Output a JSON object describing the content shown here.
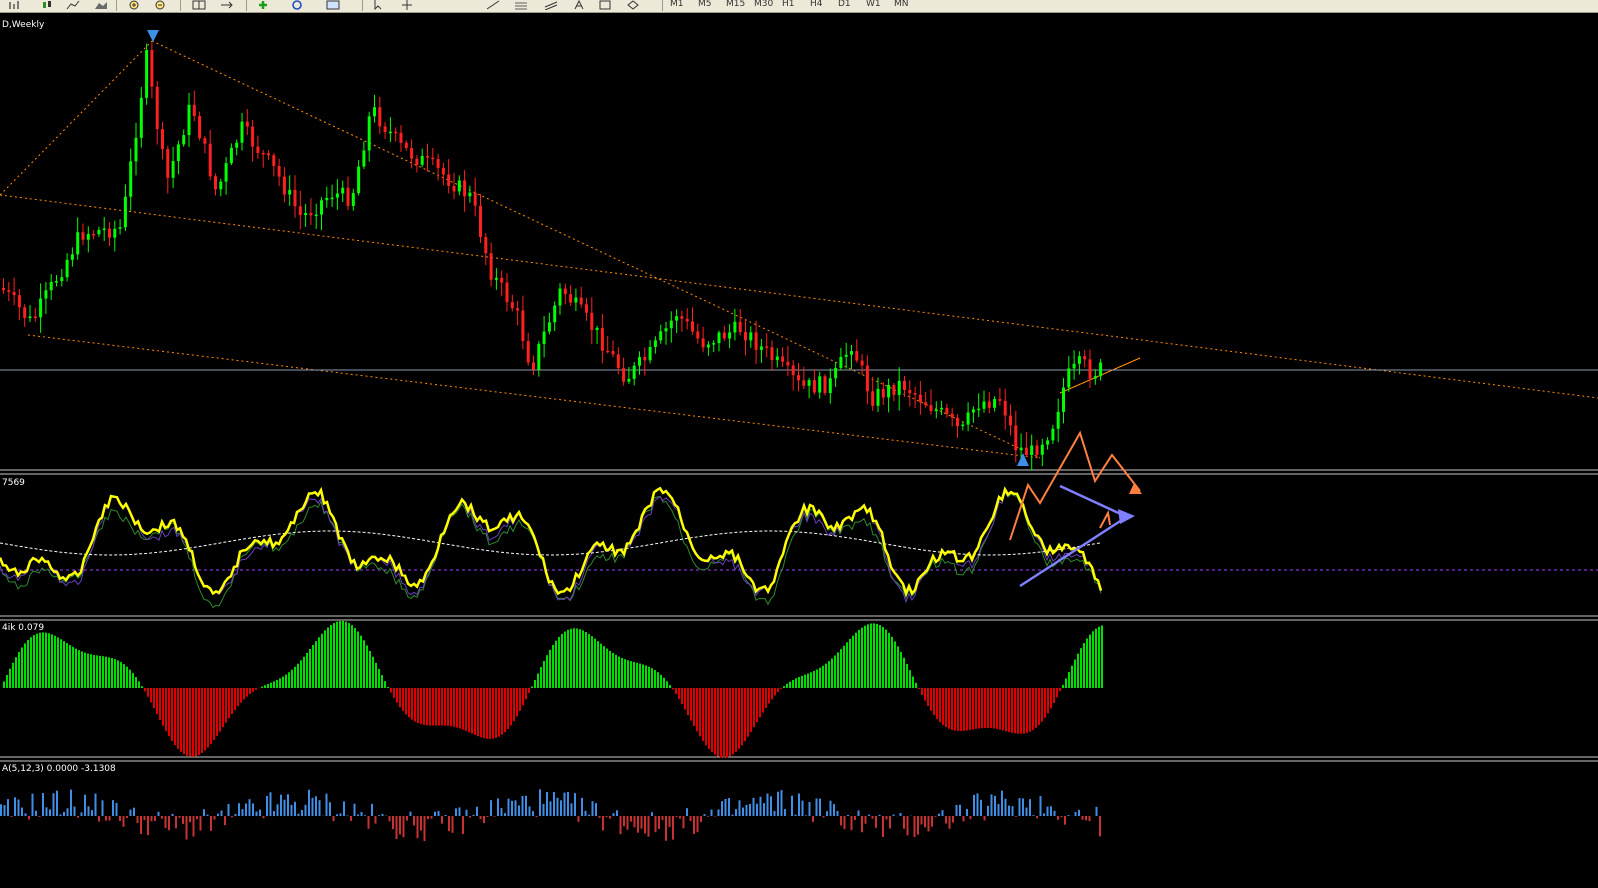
{
  "toolbar": {
    "buttons": [
      {
        "name": "zoom-in-icon"
      },
      {
        "name": "zoom-out-icon"
      },
      {
        "name": "crosshair-icon"
      },
      {
        "name": "new-order-icon"
      },
      {
        "name": "autotrading-icon"
      },
      {
        "name": "chart-template-icon"
      },
      {
        "name": "cursor-icon"
      },
      {
        "name": "trendline-icon"
      },
      {
        "name": "text-icon"
      }
    ],
    "timeframes": [
      "M1",
      "M5",
      "M15",
      "M30",
      "H1",
      "H4",
      "D1",
      "W1",
      "MN"
    ]
  },
  "main_chart": {
    "label": "D,Weekly",
    "colors": {
      "up": "#00ff00",
      "down": "#ff2020",
      "trend": "#ff8c00",
      "price_line": "#8a9bb0"
    }
  },
  "oscillator": {
    "label": "7569",
    "colors": {
      "main": "#ffff00",
      "signal": "#ffffff",
      "level": "#a040ff"
    }
  },
  "histogram1": {
    "label": "4ik 0.079",
    "colors": {
      "up": "#00e000",
      "down": "#e00000"
    }
  },
  "histogram2": {
    "label": "A(5,12,3) 0.0000 -3.1308",
    "colors": {
      "up": "#3f8fe6",
      "down": "#c83232"
    }
  },
  "annotations": {
    "forecast_color": "#ff8040",
    "triangle_color": "#7f7fff"
  }
}
